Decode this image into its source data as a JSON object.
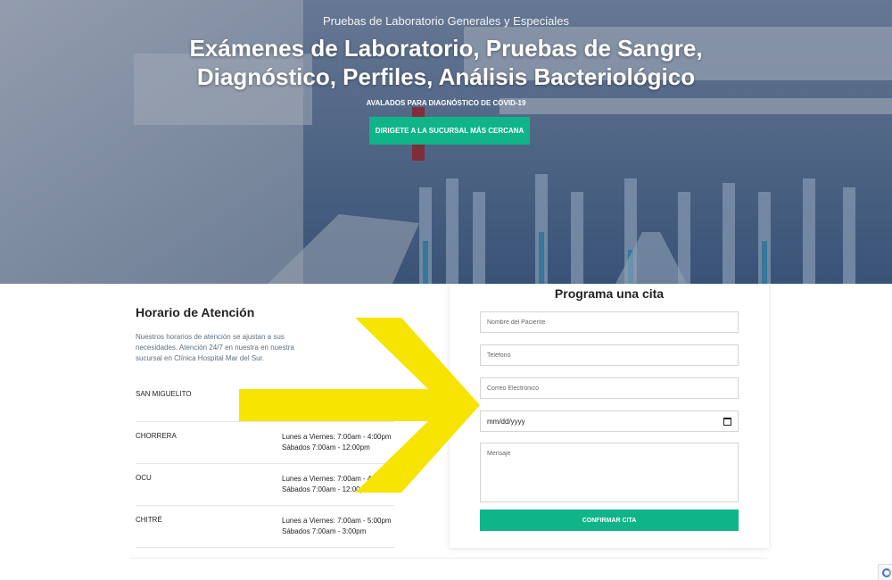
{
  "hero": {
    "eyebrow": "Pruebas de Laboratorio Generales y Especiales",
    "title": "Exámenes de Laboratorio, Pruebas de Sangre, Diagnóstico, Perfiles, Análisis Bacteriológico",
    "subtitle": "AVALADOS PARA DIAGNÓSTICO DE COVID-19",
    "button_label": "DIRIGETE A LA SUCURSAL MÁS CERCANA"
  },
  "schedule": {
    "title": "Horario de Atención",
    "description": "Nuestros horarios de atención se ajustan a sus necesidades. Atención 24/7 en nuestra en nuestra sucursal en Clínica Hospital Mar del Sur.",
    "branches": [
      {
        "name": "SAN MIGUELITO",
        "line1": "",
        "line2": ""
      },
      {
        "name": "CHORRERA",
        "line1": "Lunes a Viernes: 7:00am - 4:00pm",
        "line2": "Sábados 7:00am - 12:00pm"
      },
      {
        "name": "OCU",
        "line1": "Lunes a Viernes: 7:00am - 4:00pm",
        "line2": "Sábados 7:00am - 12:00pm"
      },
      {
        "name": "CHITRÉ",
        "line1": "Lunes a Viernes: 7:00am - 5:00pm",
        "line2": "Sábados 7:00am - 3:00pm"
      }
    ]
  },
  "form": {
    "title": "Programa una cita",
    "name_placeholder": "Nombre del Paciente",
    "phone_placeholder": "Teléfono",
    "email_placeholder": "Correo Electrónico",
    "date_value": "mm/dd/yyyy",
    "message_placeholder": "Mensaje",
    "submit_label": "CONFIRMAR CITA"
  },
  "colors": {
    "accent": "#10b489",
    "annotation_arrow": "#f7e400"
  },
  "icons": {
    "date": "calendar-icon",
    "badge": "recaptcha-icon"
  }
}
